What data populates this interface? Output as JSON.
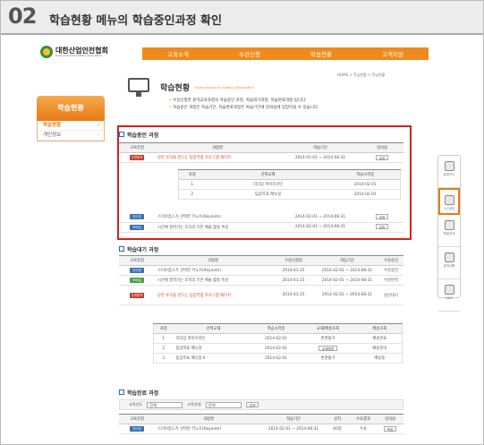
{
  "header": {
    "step": "02",
    "title": "학습현황 메뉴의 학습중인과정 확인"
  },
  "site": {
    "logo_name": "대한산업안전협회",
    "logo_sub": "Korea Industrial Safety Association",
    "gnb": [
      "교육소개",
      "수강신청",
      "학습현황",
      "고객지원"
    ]
  },
  "left": {
    "title": "학습현황",
    "items": [
      {
        "label": "학습현황",
        "on": true
      },
      {
        "label": "개인정보"
      }
    ]
  },
  "page": {
    "title": "학습현황",
    "title_en": "Korea Industrial Safety Association",
    "crumb": "HOME > 학습현황 > 학습현황",
    "desc": [
      "수강신청한 원격교육과정의 학습중인 과정, 학습대기과정, 학습완료과정 입니다.",
      "학습중인 과정은 학습기간, 학습완료과정은 복습기간에 강의실에 입장하실 수 있습니다."
    ]
  },
  "s1": {
    "title": "학습중인 과정",
    "cols": [
      "교육유형",
      "과정명",
      "학습기간",
      "강의실"
    ],
    "rows": [
      {
        "type": "우편원격",
        "tc": "#c23a2a",
        "name": "강한 조직을 만드는 팀장역량 프로그램 패키지",
        "period": "2014-02-01 ~ 2014-08-31",
        "btn": "입장"
      }
    ],
    "sub_cols": [
      "과정",
      "선택교재",
      "학습시작일"
    ],
    "sub_rows": [
      [
        "1",
        "리더십 파이프라인",
        "2014-02-01"
      ],
      [
        "2",
        "팀장목표 매뉴얼",
        "2014-02-01"
      ]
    ],
    "rows2": [
      {
        "type": "인터넷",
        "tc": "#3a6fb5",
        "name": "스티브잡스가 선택한 키노트(Keynote)",
        "period": "2014-02-01 ~ 2014-08-31",
        "btn": "입장"
      },
      {
        "type": "모바일",
        "tc": "#3a6fb5",
        "name": "시간에 끌려가는 조직의 기본 예술 활용 특강",
        "period": "2014-02-01 ~ 2014-08-31",
        "btn": "입장"
      }
    ]
  },
  "s2": {
    "title": "학습대기 과정",
    "cols": [
      "교육유형",
      "과정명",
      "수강신청일",
      "학습기간",
      "수강승인"
    ],
    "rows": [
      {
        "type": "인터넷",
        "tc": "#3a6fb5",
        "name": "스티브잡스가 선택한 키노트(Keynote)",
        "date": "2014-01-25",
        "period": "2014-02-01 ~ 2014-08-31",
        "status": "수강승인"
      },
      {
        "type": "모바일",
        "tc": "#45a046",
        "name": "시간에 끌려가는 조직의 기본 예술 활용 특강",
        "date": "2014-01-25",
        "period": "2014-02-01 ~ 2014-08-31",
        "status": "수강반려"
      },
      {
        "type": "우편원격",
        "tc": "#c23a2a",
        "name": "강한 조직을 만드는 팀장역량 프로그램 패키지",
        "date": "2014-01-25",
        "period": "2014-02-01 ~ 2014-08-31",
        "status": "승인대기"
      }
    ],
    "sub_cols": [
      "과정",
      "선택교재",
      "학습시작일",
      "교재/배송조회",
      "배송조회"
    ],
    "sub_rows": [
      [
        "1",
        "리더십 파이프라인",
        "2014-02-01",
        "변경불가",
        "배송완료"
      ],
      [
        "2",
        "팀장목표 매뉴얼",
        "2014-02-01",
        "교재변경",
        "배송준비"
      ],
      [
        "3",
        "팀장목표 매뉴얼 II",
        "2014-02-01",
        "변경불가",
        "배송중"
      ]
    ]
  },
  "s3": {
    "title": "학습완료 과정",
    "search_label": "교육년도",
    "search_sel": "전체",
    "search_label2": "교육유형",
    "search_sel2": "전체",
    "search_btn": "검색",
    "cols": [
      "교육유형",
      "과정명",
      "학습기간",
      "성적",
      "수료결과",
      "강의실"
    ],
    "rows": [
      {
        "type": "인터넷",
        "tc": "#3a6fb5",
        "name": "스티브잡스가 선택한 키노트(Keynote)",
        "period": "2014-02-01 ~ 2014-08-31",
        "score": "60점",
        "result": "수료",
        "btn": "복습"
      }
    ]
  },
  "quick": [
    "장바구니",
    "1:1상담",
    "학습안내",
    "공지사항",
    "Q&A"
  ]
}
